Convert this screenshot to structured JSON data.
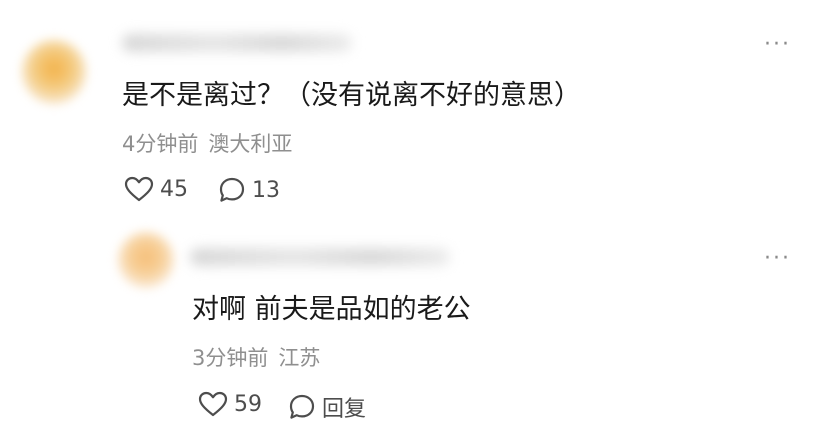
{
  "comments": [
    {
      "text": "是不是离过？（没有说离不好的意思）",
      "time": "4分钟前",
      "location": "澳大利亚",
      "likes": "45",
      "replies": "13",
      "more": "···"
    }
  ],
  "reply": {
    "text": "对啊 前夫是品如的老公",
    "time": "3分钟前",
    "location": "江苏",
    "likes": "59",
    "reply_label": "回复",
    "more": "···"
  },
  "icons": [
    "heart-icon",
    "comment-bubble-icon",
    "more-icon"
  ],
  "colors": {
    "text": "#1a1a1a",
    "meta": "#8f8f8f",
    "icon": "#4d4d4d"
  }
}
